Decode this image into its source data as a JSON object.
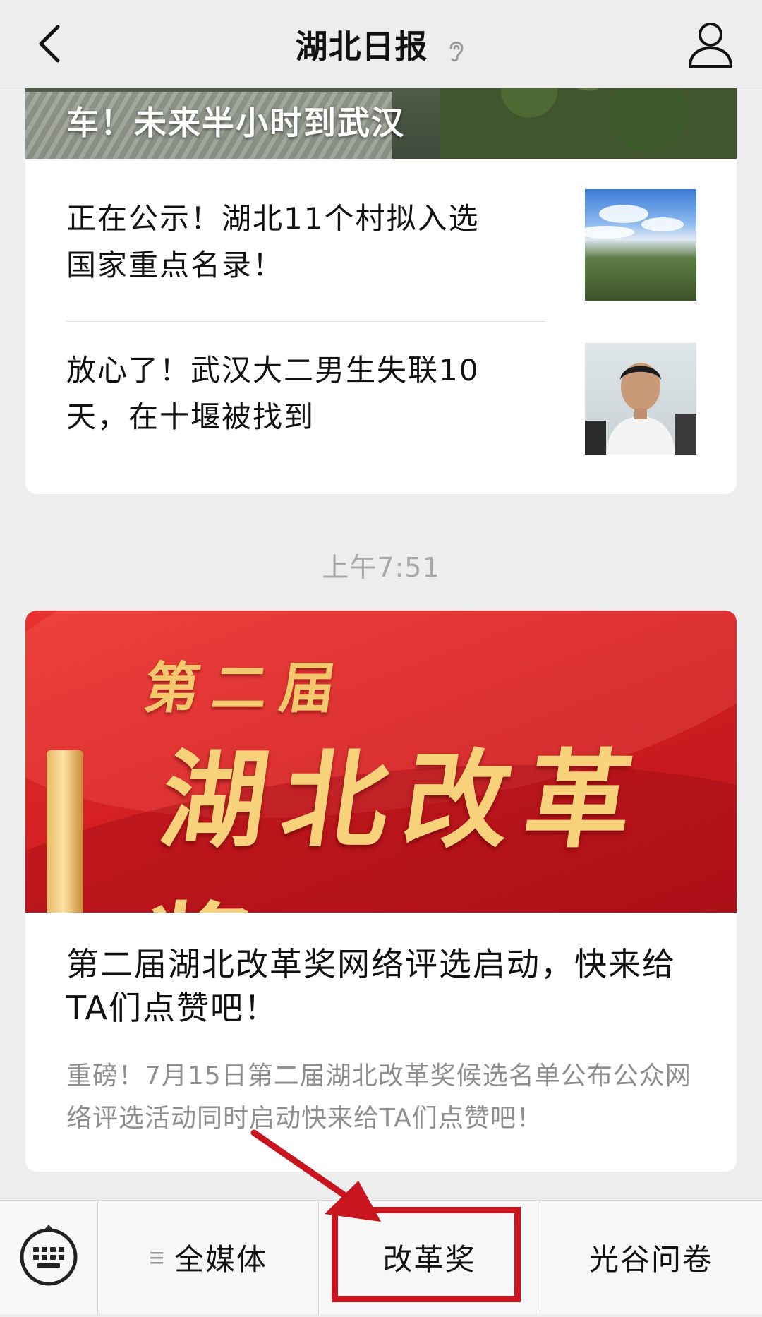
{
  "nav": {
    "title": "湖北日报"
  },
  "feed": {
    "hero_caption": "车！未来半小时到武汉",
    "items": [
      {
        "title": "正在公示！湖北11个村拟入选国家重点名录！"
      },
      {
        "title": "放心了！武汉大二男生失联10天，在十堰被找到"
      }
    ],
    "timestamp": "上午7:51",
    "feature": {
      "banner_line1": "第二届",
      "banner_line2": "湖北改革奖",
      "title": "第二届湖北改革奖网络评选启动，快来给TA们点赞吧！",
      "summary": "重磅！7月15日第二届湖北改革奖候选名单公布公众网络评选活动同时启动快来给TA们点赞吧！"
    }
  },
  "menu": {
    "items": [
      {
        "label": "全媒体",
        "has_submenu_icon": true
      },
      {
        "label": "改革奖",
        "highlighted": true
      },
      {
        "label": "光谷问卷"
      }
    ]
  },
  "colors": {
    "background": "#ededed",
    "card": "#ffffff",
    "banner_red": "#d41f22",
    "banner_gold": "#f7d27a",
    "annotation_red": "#c8141e",
    "summary_gray": "#8e8e8e"
  },
  "icons": [
    "back-chevron-icon",
    "ear-icon",
    "profile-icon",
    "keyboard-icon",
    "menu-list-icon",
    "annotation-arrow"
  ]
}
